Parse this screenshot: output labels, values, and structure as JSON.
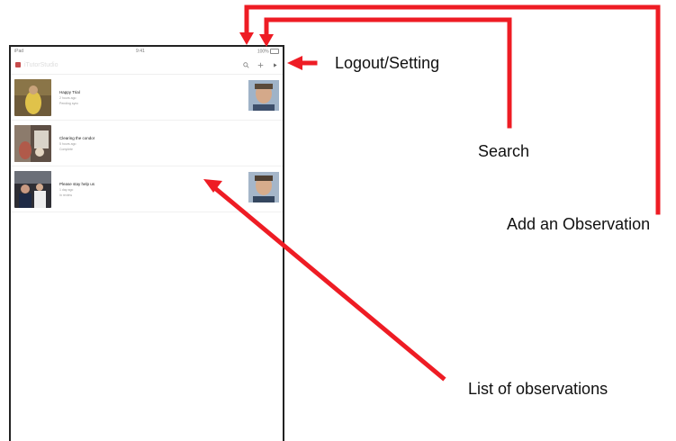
{
  "heading": "",
  "device": {
    "status_left": "iPad",
    "status_time": "9:41",
    "status_right": "100%",
    "app_title": "iTutorStudio"
  },
  "observations": [
    {
      "title": "Happy Trial",
      "meta1": "2 hours ago",
      "meta2": "Pending sync"
    },
    {
      "title": "Clearing the condor",
      "meta1": "5 hours ago",
      "meta2": "Complete"
    },
    {
      "title": "Please stay help us",
      "meta1": "1 day ago",
      "meta2": "In review"
    }
  ],
  "callouts": {
    "logout_setting": "Logout/Setting",
    "search": "Search",
    "add_observation": "Add an Observation",
    "list_of_observations": "List of observations"
  },
  "colors": {
    "arrow": "#ee1c24",
    "frame": "#222222",
    "logo": "#c64b4b"
  },
  "icons": [
    "search-icon",
    "add-icon",
    "logout-setting-icon"
  ]
}
